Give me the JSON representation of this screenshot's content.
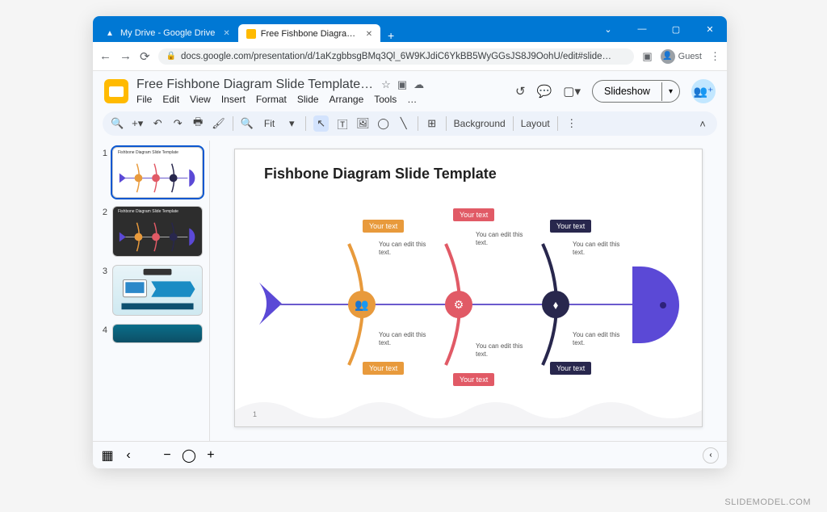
{
  "watermark": "SLIDEMODEL.COM",
  "browser": {
    "tabs": [
      {
        "title": "My Drive - Google Drive",
        "active": false
      },
      {
        "title": "Free Fishbone Diagram Slide Tem",
        "active": true
      }
    ],
    "url": "docs.google.com/presentation/d/1aKzgbbsgBMq3Ql_6W9KJdiC6YkBB5WyGGsJS8J9OohU/edit#slide…",
    "guest_label": "Guest"
  },
  "app": {
    "doc_title": "Free Fishbone Diagram Slide Template…",
    "menus": [
      "File",
      "Edit",
      "View",
      "Insert",
      "Format",
      "Slide",
      "Arrange",
      "Tools",
      "…"
    ],
    "slideshow_label": "Slideshow",
    "toolbar": {
      "fit_label": "Fit",
      "background_label": "Background",
      "layout_label": "Layout"
    },
    "thumbs": [
      "1",
      "2",
      "3",
      "4"
    ],
    "slide": {
      "title": "Fishbone Diagram Slide Template",
      "page_number": "1",
      "bones": [
        {
          "color": "#e89a3c",
          "node_icon": "people",
          "top_label": "Your text",
          "bottom_label": "Your text",
          "top_text": "You can edit this text.",
          "bottom_text": "You can edit this text."
        },
        {
          "color": "#e15a66",
          "node_icon": "gear",
          "top_label": "Your text",
          "bottom_label": "Your text",
          "top_text": "You can edit this text.",
          "bottom_text": "You can edit this text."
        },
        {
          "color": "#28274d",
          "node_icon": "flow",
          "top_label": "Your text",
          "bottom_label": "Your text",
          "top_text": "You can edit this text.",
          "bottom_text": "You can edit this text."
        }
      ]
    }
  }
}
